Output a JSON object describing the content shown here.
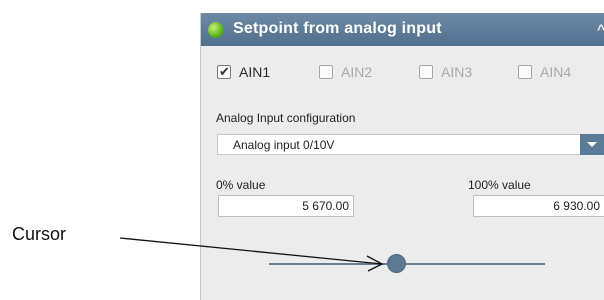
{
  "panel": {
    "title": "Setpoint from analog input",
    "inputs": [
      {
        "label": "AIN1",
        "checked": true,
        "enabled": true
      },
      {
        "label": "AIN2",
        "checked": false,
        "enabled": false
      },
      {
        "label": "AIN3",
        "checked": false,
        "enabled": false
      },
      {
        "label": "AIN4",
        "checked": false,
        "enabled": false
      }
    ],
    "config_label": "Analog Input configuration",
    "config_value": "Analog input 0/10V",
    "zero_label": "0% value",
    "zero_value": "5 670.00",
    "hundred_label": "100% value",
    "hundred_value": "6 930.00",
    "slider_fraction": 0.43
  },
  "annotation": {
    "label": "Cursor"
  },
  "colors": {
    "title_bar": "#5d7b98",
    "slider": "#5d7891",
    "status_dot": "#59b21a"
  },
  "icons": {
    "status": "status-dot-icon",
    "collapse": "chevron-up-icon",
    "dropdown": "triangle-down-icon",
    "checked": "checkmark-icon"
  }
}
